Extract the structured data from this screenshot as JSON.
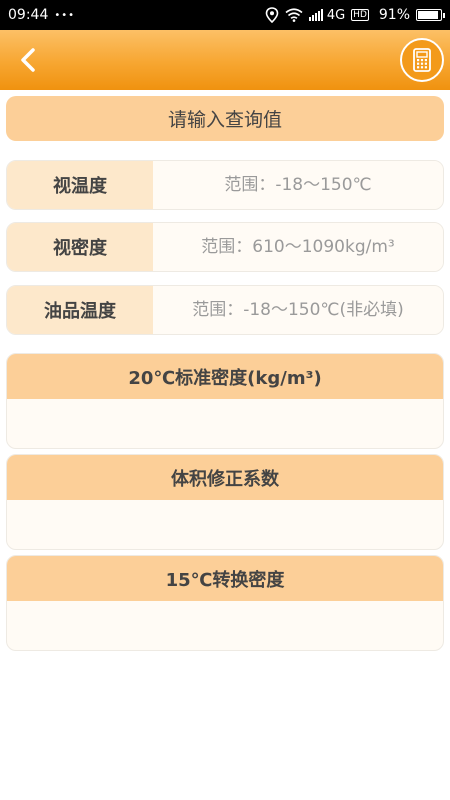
{
  "status_bar": {
    "time": "09:44",
    "notification_dots": "•••",
    "network": "4G",
    "hd": "HD",
    "battery_percent_text": "91%",
    "battery_level": 0.91
  },
  "header": {
    "back_icon": "chevron-left-icon",
    "calculator_icon": "calculator-icon"
  },
  "title_bar": {
    "text": "请输入查询值"
  },
  "inputs": [
    {
      "label": "视温度",
      "placeholder": "范围：-18～150℃",
      "value": ""
    },
    {
      "label": "视密度",
      "placeholder": "范围：610～1090kg/m³",
      "value": ""
    },
    {
      "label": "油品温度",
      "placeholder": "范围：-18～150℃(非必填)",
      "value": ""
    }
  ],
  "results": [
    {
      "title": "20℃标准密度(kg/m³)",
      "value": ""
    },
    {
      "title": "体积修正系数",
      "value": ""
    },
    {
      "title": "15℃转换密度",
      "value": ""
    }
  ],
  "colors": {
    "header_gradient_top": "#fcc066",
    "header_gradient_bottom": "#f0920f",
    "title_bar_bg": "#fccf98",
    "label_bg": "#fde8cb",
    "field_bg": "#fffbf5"
  }
}
